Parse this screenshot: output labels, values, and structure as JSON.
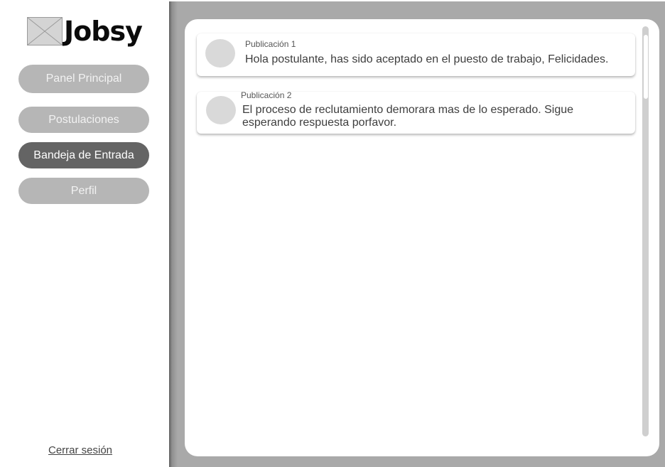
{
  "app": {
    "name": "Jobsy"
  },
  "sidebar": {
    "logo_icon": "image-placeholder-icon",
    "items": [
      {
        "label": "Panel Principal",
        "active": false
      },
      {
        "label": "Postulaciones",
        "active": false
      },
      {
        "label": "Bandeja de Entrada",
        "active": true
      },
      {
        "label": "Perfil",
        "active": false
      }
    ],
    "logout_label": "Cerrar sesión"
  },
  "inbox": {
    "messages": [
      {
        "title": "Publicación 1",
        "body": "Hola postulante, has sido aceptado en el puesto de trabajo, Felicidades."
      },
      {
        "title": "Publicación 2",
        "body": "El proceso de reclutamiento demorara mas de lo esperado. Sigue esperando respuesta porfavor."
      }
    ]
  },
  "colors": {
    "nav_inactive": "#b6b6b6",
    "nav_active": "#646464",
    "main_background": "#a9a9a9",
    "avatar": "#d9d9d9"
  }
}
